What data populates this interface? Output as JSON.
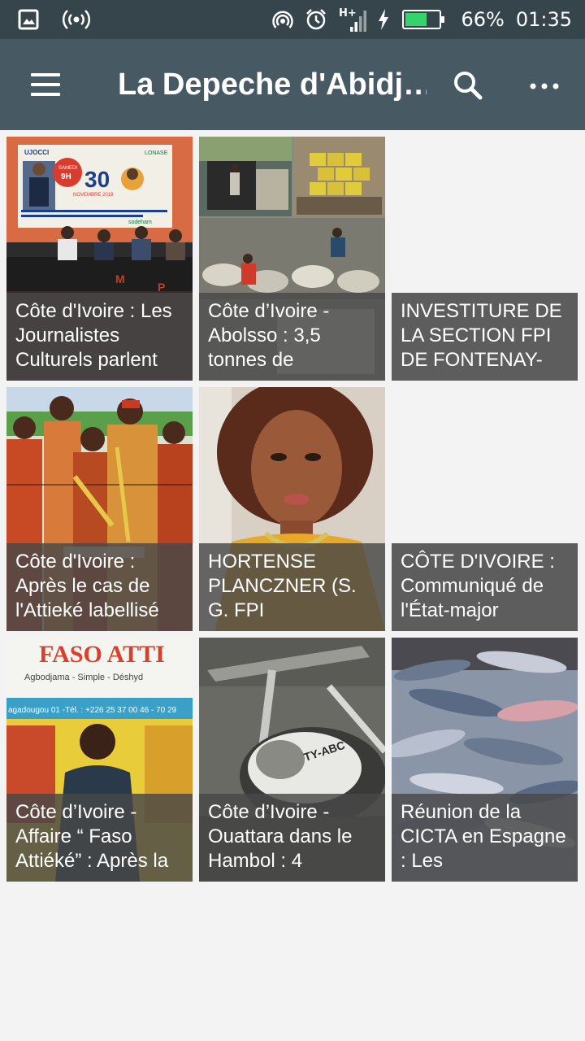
{
  "status_bar": {
    "icons": [
      "gallery-icon",
      "radio-broadcast-icon",
      "hotspot-icon",
      "alarm-icon",
      "signal-h-plus-icon",
      "charging-icon",
      "battery-icon"
    ],
    "signal_label": "H+",
    "battery_percent": "66%",
    "battery_level": 0.66,
    "time": "01:35"
  },
  "app_bar": {
    "title": "La Depeche d'Abidj…",
    "icons": [
      "menu-icon",
      "search-icon",
      "more-vert-icon"
    ]
  },
  "colors": {
    "status_bar_bg": "#36444c",
    "app_bar_bg": "#475a63",
    "page_bg": "#f3f3f3",
    "caption_bg": "#5d5d5d",
    "battery_fill": "#34d46b"
  },
  "articles": [
    {
      "caption": "Côte d'Ivoire : Les Journalistes Culturels parlent",
      "image": "journalists-press-conference"
    },
    {
      "caption": "Côte d’Ivoire - Abolsso : 3,5 tonnes de",
      "image": "sacks-seizure"
    },
    {
      "caption": "INVESTITURE DE LA SECTION FPI DE FONTENAY-",
      "image": ""
    },
    {
      "caption": "Côte d'Ivoire : Après le cas de l'Attieké labellisé",
      "image": "women-traditional-dress"
    },
    {
      "caption": "HORTENSE PLANCZNER (S. G. FPI",
      "image": "woman-portrait"
    },
    {
      "caption": "CÔTE D'IVOIRE : Communiqué de l'État-major",
      "image": ""
    },
    {
      "caption": "Côte d’Ivoire - Affaire “ Faso Attiéké” : Après la",
      "image": "faso-attieke-sign"
    },
    {
      "caption": "Côte d’Ivoire - Ouattara dans le Hambol : 4",
      "image": "helicopter-wreck"
    },
    {
      "caption": "Réunion de la CICTA en Espagne : Les",
      "image": "fish-market"
    }
  ],
  "banner_text": {
    "org": "UJOCCI",
    "org2": "LONASE",
    "day": "SAMEDI",
    "hour": "9H",
    "date": "30",
    "month": "NOVEMBRE 2019",
    "sponsor": "sodeham"
  },
  "sign_text": {
    "title": "FASO ATTI",
    "line2": "Agbodjama - Simple - Déshyd",
    "line3": "agadougou 01 -Tél. : +226 25 37 00 46 - 70 29"
  },
  "heli_reg": "TY-ABC"
}
